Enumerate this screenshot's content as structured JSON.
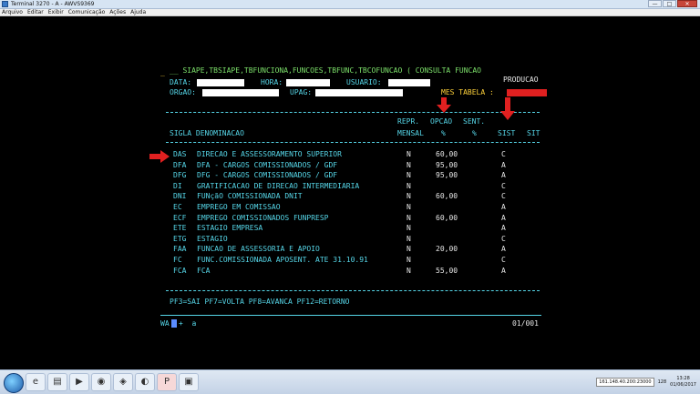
{
  "window": {
    "title": "Terminal 3270 - A - AWVS9369",
    "buttons": [
      "—",
      "□",
      "✕"
    ]
  },
  "menu": [
    "Arquivo",
    "Editar",
    "Exibir",
    "Comunicação",
    "Ações",
    "Ajuda"
  ],
  "header": {
    "line1": "__ SIAPE,TBSIAPE,TBFUNCIONA,FUNCOES,TBFUNC,TBCOFUNCAO ( CONSULTA FUNCAO",
    "producao": "PRODUCAO",
    "data_label": "DATA:",
    "hora_label": "HORA:",
    "usuario_label": "USUARIO:",
    "orgao_label": "ORGAO:",
    "upag_label": "UPAG:",
    "mes_label": "MES TABELA :"
  },
  "columns": {
    "repr1": "REPR.",
    "opcao1": "OPCAO",
    "sent1": "SENT.",
    "sigla_den": "SIGLA DENOMINACAO",
    "repr2": "MENSAL",
    "opcao2": "%",
    "sent2": "%",
    "sist": "SIST",
    "sit": "SIT"
  },
  "rows": [
    {
      "sigla": "DAS",
      "den": "DIRECAO E ASSESSORAMENTO SUPERIOR",
      "repr": "N",
      "opcao": "60,00",
      "sist": "C"
    },
    {
      "sigla": "DFA",
      "den": "DFA - CARGOS COMISSIONADOS / GDF",
      "repr": "N",
      "opcao": "95,00",
      "sist": "A"
    },
    {
      "sigla": "DFG",
      "den": "DFG - CARGOS COMISSIONADOS / GDF",
      "repr": "N",
      "opcao": "95,00",
      "sist": "A"
    },
    {
      "sigla": "DI",
      "den": "GRATIFICACAO DE DIRECAO INTERMEDIARIA",
      "repr": "N",
      "opcao": "",
      "sist": "C"
    },
    {
      "sigla": "DNI",
      "den": "FUNçãO COMISSIONADA DNIT",
      "repr": "N",
      "opcao": "60,00",
      "sist": "C"
    },
    {
      "sigla": "EC",
      "den": "EMPREGO EM COMISSAO",
      "repr": "N",
      "opcao": "",
      "sist": "A"
    },
    {
      "sigla": "ECF",
      "den": "EMPREGO COMISSIONADOS FUNPRESP",
      "repr": "N",
      "opcao": "60,00",
      "sist": "A"
    },
    {
      "sigla": "ETE",
      "den": "ESTAGIO EMPRESA",
      "repr": "N",
      "opcao": "",
      "sist": "A"
    },
    {
      "sigla": "ETG",
      "den": "ESTAGIO",
      "repr": "N",
      "opcao": "",
      "sist": "C"
    },
    {
      "sigla": "FAA",
      "den": "FUNCAO DE ASSESSORIA E APOIO",
      "repr": "N",
      "opcao": "20,00",
      "sist": "A"
    },
    {
      "sigla": "FC",
      "den": "FUNC.COMISSIONADA APOSENT. ATE 31.10.91",
      "repr": "N",
      "opcao": "",
      "sist": "C"
    },
    {
      "sigla": "FCA",
      "den": "FCA",
      "repr": "N",
      "opcao": "55,00",
      "sist": "A"
    }
  ],
  "footer": {
    "keys": "PF3=SAI PF7=VOLTA PF8=AVANCA PF12=RETORNO",
    "cmd": "WA",
    "cmd_rest": "+  a",
    "page": "01/001"
  },
  "taskbar": {
    "ip": "161.148.40.200:23000",
    "extra": "128",
    "time": "13:28",
    "date": "01/06/2017"
  },
  "colors": {
    "cyan": "#56d6e8",
    "green": "#7ce06a",
    "arrow": "#e02020"
  }
}
